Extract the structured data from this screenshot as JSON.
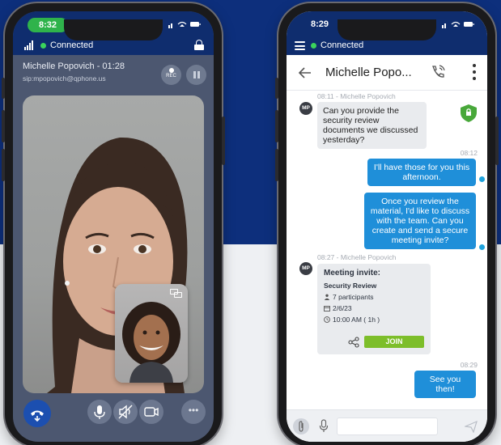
{
  "left_phone": {
    "status": {
      "time": "8:32",
      "connection": "Connected"
    },
    "call": {
      "caller_line": "Michelle Popovich - 01:28",
      "sip": "sip:mpopovich@qphone.us",
      "rec_label": "REC",
      "more_label": "•••"
    }
  },
  "right_phone": {
    "status": {
      "time": "8:29",
      "connection": "Connected"
    },
    "header": {
      "title": "Michelle Popo..."
    },
    "messages": {
      "m1_meta": "08:11 - Michelle Popovich",
      "m1_avatar": "MP",
      "m1_text": "Can you provide the security review documents we discussed yesterday?",
      "m2_time": "08:12",
      "m2_text": "I'll have those for you this afternoon.",
      "m3_text": "Once you review the material, I'd like to discuss with the team. Can you create and send a secure meeting invite?",
      "m4_meta": "08:27 - Michelle Popovich",
      "m4_avatar": "MP",
      "m5_time": "08:29",
      "m5_text": "See you then!"
    },
    "invite": {
      "title": "Meeting invite:",
      "subject": "Security Review",
      "participants": "7 participants",
      "date": "2/6/23",
      "time": "10:00 AM ( 1h )",
      "join_label": "JOIN"
    }
  },
  "colors": {
    "brand_navy": "#0f2d6e",
    "accent_blue": "#1f8fd9",
    "join_green": "#7dbe2a",
    "connected_green": "#3bd35c"
  }
}
